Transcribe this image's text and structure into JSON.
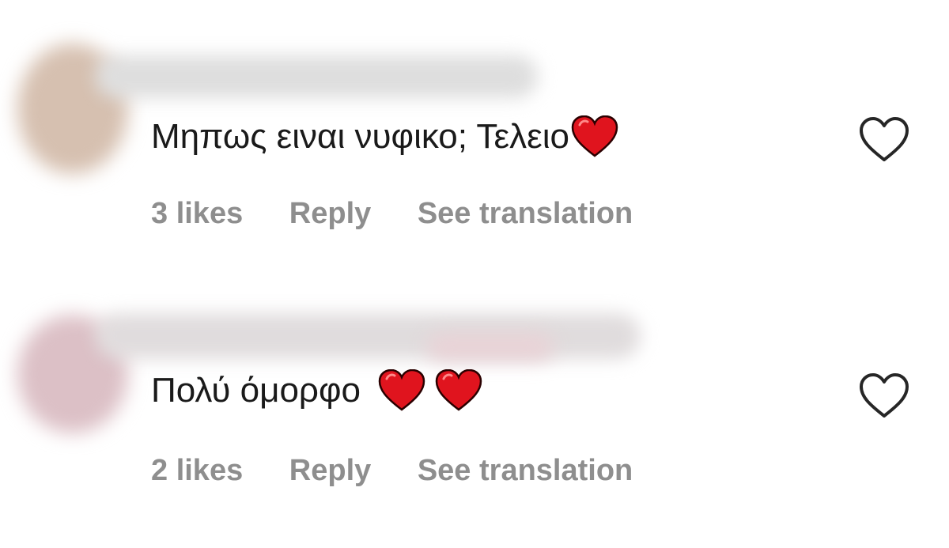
{
  "comments": [
    {
      "text": "Μηπως ειναι νυφικο; Τελειο",
      "emoji": [
        "red-heart"
      ],
      "likes_label": "3 likes",
      "reply_label": "Reply",
      "translate_label": "See translation"
    },
    {
      "text": "Πολύ όμορφο",
      "emoji": [
        "red-heart",
        "red-heart"
      ],
      "likes_label": "2 likes",
      "reply_label": "Reply",
      "translate_label": "See translation"
    }
  ],
  "icons": {
    "emoji": "red-heart",
    "like": "heart-outline-icon"
  },
  "colors": {
    "text": "#1a1a1a",
    "meta_text": "#8e8e8e",
    "heart_emoji": "#e0141e",
    "heart_outline": "#262626",
    "background": "#ffffff"
  }
}
